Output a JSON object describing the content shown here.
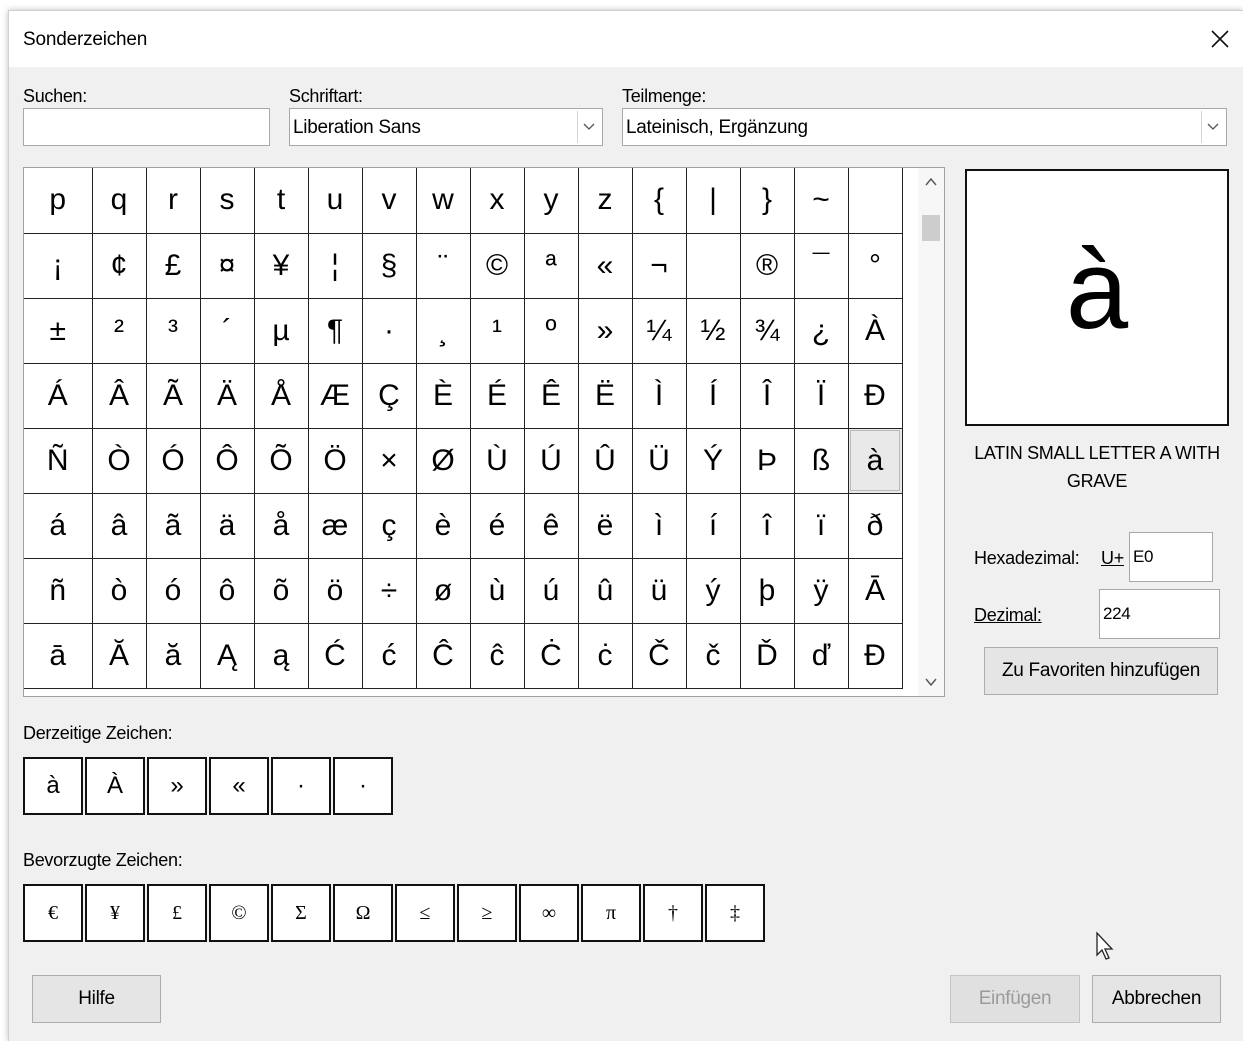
{
  "dialog": {
    "title": "Sonderzeichen",
    "close_icon": "close-icon"
  },
  "search": {
    "label": "Suchen:",
    "value": ""
  },
  "font": {
    "label": "Schriftart:",
    "value": "Liberation Sans"
  },
  "subset": {
    "label": "Teilmenge:",
    "value": "Lateinisch, Ergänzung"
  },
  "grid": {
    "rows": [
      [
        "p",
        "q",
        "r",
        "s",
        "t",
        "u",
        "v",
        "w",
        "x",
        "y",
        "z",
        "{",
        "|",
        "}",
        "~",
        ""
      ],
      [
        "¡",
        "¢",
        "£",
        "¤",
        "¥",
        "¦",
        "§",
        "¨",
        "©",
        "ª",
        "«",
        "¬",
        "",
        "®",
        "¯",
        "°"
      ],
      [
        "±",
        "²",
        "³",
        "´",
        "µ",
        "¶",
        "·",
        "¸",
        "¹",
        "º",
        "»",
        "¼",
        "½",
        "¾",
        "¿",
        "À"
      ],
      [
        "Á",
        "Â",
        "Ã",
        "Ä",
        "Å",
        "Æ",
        "Ç",
        "È",
        "É",
        "Ê",
        "Ë",
        "Ì",
        "Í",
        "Î",
        "Ï",
        "Ð"
      ],
      [
        "Ñ",
        "Ò",
        "Ó",
        "Ô",
        "Õ",
        "Ö",
        "×",
        "Ø",
        "Ù",
        "Ú",
        "Û",
        "Ü",
        "Ý",
        "Þ",
        "ß",
        "à"
      ],
      [
        "á",
        "â",
        "ã",
        "ä",
        "å",
        "æ",
        "ç",
        "è",
        "é",
        "ê",
        "ë",
        "ì",
        "í",
        "î",
        "ï",
        "ð"
      ],
      [
        "ñ",
        "ò",
        "ó",
        "ô",
        "õ",
        "ö",
        "÷",
        "ø",
        "ù",
        "ú",
        "û",
        "ü",
        "ý",
        "þ",
        "ÿ",
        "Ā"
      ],
      [
        "ā",
        "Ă",
        "ă",
        "Ą",
        "ą",
        "Ć",
        "ć",
        "Ĉ",
        "ĉ",
        "Ċ",
        "ċ",
        "Č",
        "č",
        "Ď",
        "ď",
        "Đ"
      ]
    ],
    "selected": "à"
  },
  "preview": {
    "char": "à",
    "name": "LATIN SMALL LETTER A WITH GRAVE"
  },
  "hex": {
    "label": "Hexadezimal:",
    "prefix": "U+",
    "value": "E0"
  },
  "decimal": {
    "label": "Dezimal:",
    "value": "224"
  },
  "add_favorite_label": "Zu Favoriten hinzufügen",
  "recent": {
    "label": "Derzeitige Zeichen:",
    "chars": [
      "à",
      "À",
      "»",
      "«",
      "·",
      "·"
    ]
  },
  "favorites": {
    "label": "Bevorzugte Zeichen:",
    "chars": [
      "€",
      "¥",
      "£",
      "©",
      "Σ",
      "Ω",
      "≤",
      "≥",
      "∞",
      "π",
      "†",
      "‡"
    ]
  },
  "buttons": {
    "help": "Hilfe",
    "insert": "Einfügen",
    "cancel": "Abbrechen"
  }
}
